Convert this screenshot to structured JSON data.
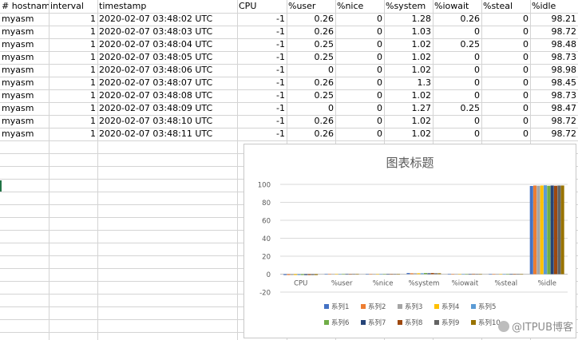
{
  "sheet": {
    "headers": [
      "# hostname",
      "interval",
      "timestamp",
      "CPU",
      "%user",
      "%nice",
      "%system",
      "%iowait",
      "%steal",
      "%idle"
    ],
    "rows": [
      [
        "myasm",
        "1",
        "2020-02-07 03:48:02 UTC",
        "-1",
        "0.26",
        "0",
        "1.28",
        "0.26",
        "0",
        "98.21"
      ],
      [
        "myasm",
        "1",
        "2020-02-07 03:48:03 UTC",
        "-1",
        "0.26",
        "0",
        "1.03",
        "0",
        "0",
        "98.72"
      ],
      [
        "myasm",
        "1",
        "2020-02-07 03:48:04 UTC",
        "-1",
        "0.25",
        "0",
        "1.02",
        "0.25",
        "0",
        "98.48"
      ],
      [
        "myasm",
        "1",
        "2020-02-07 03:48:05 UTC",
        "-1",
        "0.25",
        "0",
        "1.02",
        "0",
        "0",
        "98.73"
      ],
      [
        "myasm",
        "1",
        "2020-02-07 03:48:06 UTC",
        "-1",
        "0",
        "0",
        "1.02",
        "0",
        "0",
        "98.98"
      ],
      [
        "myasm",
        "1",
        "2020-02-07 03:48:07 UTC",
        "-1",
        "0.26",
        "0",
        "1.3",
        "0",
        "0",
        "98.45"
      ],
      [
        "myasm",
        "1",
        "2020-02-07 03:48:08 UTC",
        "-1",
        "0.25",
        "0",
        "1.02",
        "0",
        "0",
        "98.73"
      ],
      [
        "myasm",
        "1",
        "2020-02-07 03:48:09 UTC",
        "-1",
        "0",
        "0",
        "1.27",
        "0.25",
        "0",
        "98.47"
      ],
      [
        "myasm",
        "1",
        "2020-02-07 03:48:10 UTC",
        "-1",
        "0.26",
        "0",
        "1.02",
        "0",
        "0",
        "98.72"
      ],
      [
        "myasm",
        "1",
        "2020-02-07 03:48:11 UTC",
        "-1",
        "0.26",
        "0",
        "1.02",
        "0",
        "0",
        "98.72"
      ]
    ]
  },
  "chart_data": {
    "type": "bar",
    "title": "图表标题",
    "categories": [
      "CPU",
      "%user",
      "%nice",
      "%system",
      "%iowait",
      "%steal",
      "%idle"
    ],
    "ylim": [
      -20,
      100
    ],
    "yticks": [
      -20,
      0,
      20,
      40,
      60,
      80,
      100
    ],
    "grid": true,
    "legend": "bottom",
    "series": [
      {
        "name": "系列1",
        "color": "#4472C4",
        "values": [
          -1,
          0.26,
          0,
          1.28,
          0.26,
          0,
          98.21
        ]
      },
      {
        "name": "系列2",
        "color": "#ED7D31",
        "values": [
          -1,
          0.26,
          0,
          1.03,
          0,
          0,
          98.72
        ]
      },
      {
        "name": "系列3",
        "color": "#A5A5A5",
        "values": [
          -1,
          0.25,
          0,
          1.02,
          0.25,
          0,
          98.48
        ]
      },
      {
        "name": "系列4",
        "color": "#FFC000",
        "values": [
          -1,
          0.25,
          0,
          1.02,
          0,
          0,
          98.73
        ]
      },
      {
        "name": "系列5",
        "color": "#5B9BD5",
        "values": [
          -1,
          0,
          0,
          1.02,
          0,
          0,
          98.98
        ]
      },
      {
        "name": "系列6",
        "color": "#70AD47",
        "values": [
          -1,
          0.26,
          0,
          1.3,
          0,
          0,
          98.45
        ]
      },
      {
        "name": "系列7",
        "color": "#264478",
        "values": [
          -1,
          0.25,
          0,
          1.02,
          0,
          0,
          98.73
        ]
      },
      {
        "name": "系列8",
        "color": "#9E480E",
        "values": [
          -1,
          0,
          0,
          1.27,
          0.25,
          0,
          98.47
        ]
      },
      {
        "name": "系列9",
        "color": "#636363",
        "values": [
          -1,
          0.26,
          0,
          1.02,
          0,
          0,
          98.72
        ]
      },
      {
        "name": "系列10",
        "color": "#997300",
        "values": [
          -1,
          0.26,
          0,
          1.02,
          0,
          0,
          98.72
        ]
      }
    ]
  },
  "watermark": {
    "text": "@ITPUB博客"
  }
}
